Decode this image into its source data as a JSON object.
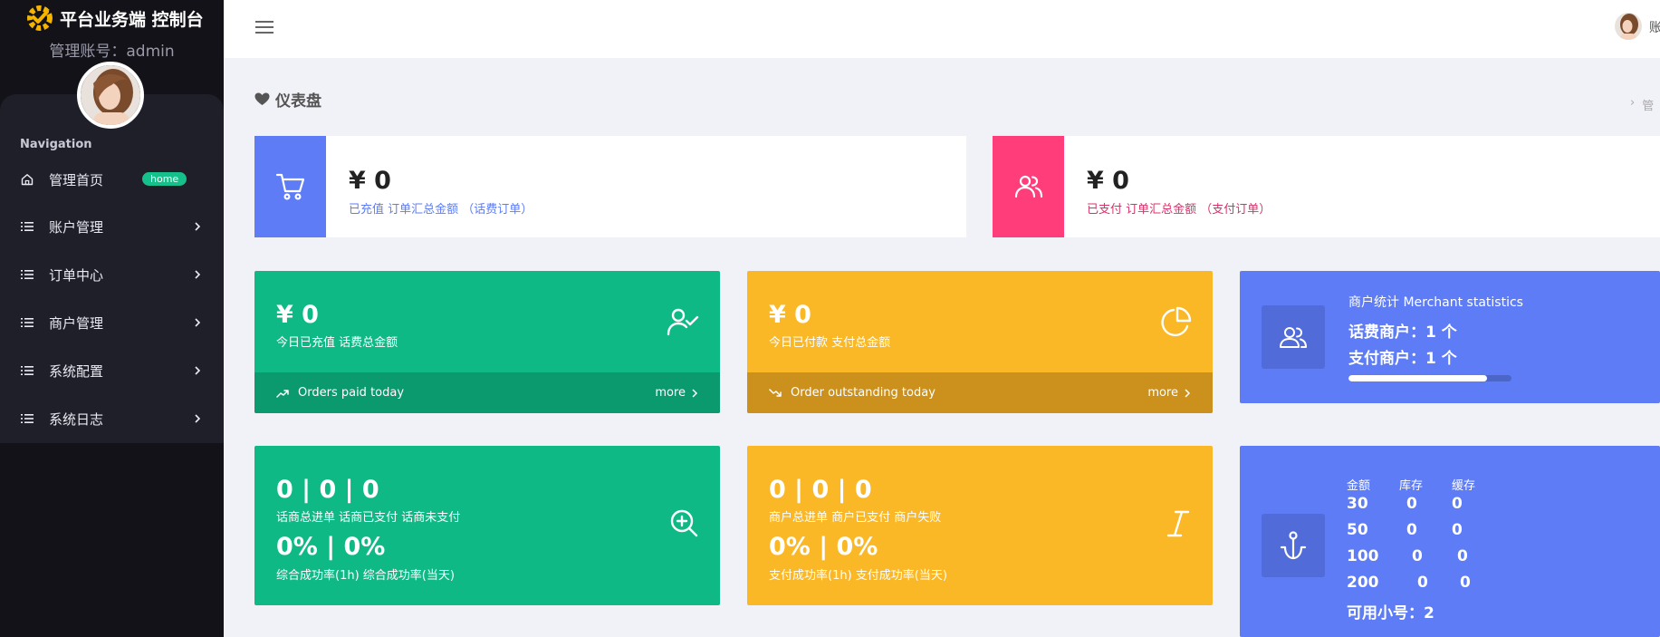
{
  "app": {
    "title": "平台业务端 控制台",
    "admin_account": "管理账号：admin"
  },
  "sidebar": {
    "nav_title": "Navigation",
    "items": [
      {
        "label": "管理首页",
        "icon": "home-icon",
        "badge": "home"
      },
      {
        "label": "账户管理",
        "icon": "list-icon"
      },
      {
        "label": "订单中心",
        "icon": "list-icon"
      },
      {
        "label": "商户管理",
        "icon": "list-icon"
      },
      {
        "label": "系统配置",
        "icon": "list-icon"
      },
      {
        "label": "系统日志",
        "icon": "list-icon"
      }
    ]
  },
  "topbar": {
    "user_name": "账"
  },
  "page": {
    "title": "仪表盘",
    "breadcrumb": "管"
  },
  "summary_cards": [
    {
      "value": "¥ 0",
      "label": "已充值 订单汇总金额 （话费订单）",
      "color": "#5d7cf6",
      "label_color": "#5d7cf6",
      "icon": "cart-icon"
    },
    {
      "value": "¥ 0",
      "label": "已支付 订单汇总金额 （支付订单）",
      "color": "#ff3d7b",
      "label_color": "#d6336c",
      "icon": "users-icon"
    }
  ],
  "today_cards": [
    {
      "value": "¥ 0",
      "label": "今日已充值 话费总金额",
      "footer": "Orders paid today",
      "more": "more",
      "color": "#0fb985",
      "footer_color": "#0a9a6e",
      "icon": "user-check-icon",
      "trend_icon": "trending-up-icon"
    },
    {
      "value": "¥ 0",
      "label": "今日已付款 支付总金额",
      "footer": "Order outstanding today",
      "more": "more",
      "color": "#fbb826",
      "footer_color": "#cc911c",
      "icon": "pie-chart-icon",
      "trend_icon": "trending-down-icon"
    }
  ],
  "merchant_stats": {
    "title": "商户统计 Merchant statistics",
    "huafei": "话费商户：1 个",
    "zhifu": "支付商户：1 个",
    "progress": 0.85,
    "color": "#5d7cf6",
    "icon": "users-icon"
  },
  "total_cards": [
    {
      "line1": "0 | 0 | 0",
      "labels1": "话商总进单   话商已支付   话商未支付",
      "line2": "0% | 0%",
      "labels2": "综合成功率(1h)   综合成功率(当天)",
      "color": "#0fb985",
      "icon": "zoom-in-icon"
    },
    {
      "line1": "0 | 0 | 0",
      "labels1": "商户总进单   商户已支付   商户失败",
      "line2": "0% | 0%",
      "labels2": "支付成功率(1h)   支付成功率(当天)",
      "color": "#fbb826",
      "icon": "italic-icon"
    }
  ],
  "stock": {
    "headers": [
      "金额",
      "库存",
      "缓存"
    ],
    "rows": [
      [
        "30",
        "0",
        "0"
      ],
      [
        "50",
        "0",
        "0"
      ],
      [
        "100",
        "0",
        "0"
      ],
      [
        "200",
        "0",
        "0"
      ]
    ],
    "available": "可用小号：2",
    "color": "#5d7cf6",
    "icon": "anchor-icon"
  }
}
